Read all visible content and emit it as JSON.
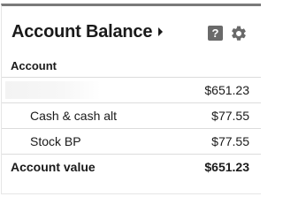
{
  "widget": {
    "title": "Account Balance",
    "help_label": "?",
    "section_label": "Account",
    "rows": [
      {
        "label": "",
        "value": "$651.23"
      },
      {
        "label": "Cash & cash alt",
        "value": "$77.55"
      },
      {
        "label": "Stock BP",
        "value": "$77.55"
      }
    ],
    "total": {
      "label": "Account value",
      "value": "$651.23"
    }
  },
  "colors": {
    "header_bar": "#7a7a7a",
    "icon_fill": "#6a6a6a",
    "divider": "#dcdcdc"
  },
  "icons": [
    "help-icon",
    "gear-icon",
    "caret-right-icon"
  ]
}
